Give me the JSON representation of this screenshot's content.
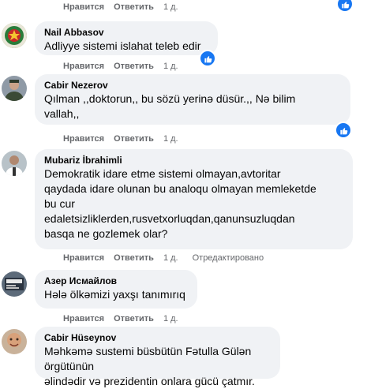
{
  "labels": {
    "like": "Нравится",
    "reply": "Ответить",
    "edited": "Отредактировано"
  },
  "comments": [
    {
      "author": "Nail Abbasov",
      "text": "Adliyye sistemi islahat teleb edir",
      "time": "1 д.",
      "reaction": "like-icon"
    },
    {
      "author": "Cabir Nezerov",
      "text": "Qılman ,,doktorun,, bu sözü yerinə düsür.,, Nə bilim\nvallah,,",
      "time": "1 д.",
      "reaction": "like-icon"
    },
    {
      "author": "Mubariz İbrahimli",
      "text": "Demokratik idare etme sistemi olmayan,avtoritar\nqaydada idare olunan bu analoqu olmayan memleketde\nbu cur\nedaletsizliklerden,rusvetxorluqdan,qanunsuzluqdan\nbasqa ne gozlemek olar?",
      "time": "1 д."
    },
    {
      "author": "Азер Исмайлов",
      "text": "Hələ ölkəmizi yaxşı tanımırıq",
      "time": "1 д."
    },
    {
      "author": "Cabir Hüseynov",
      "text": "Məhkəmə sustemi büsbütün Fətulla Gülən örgütünün\nəlindədir və prezidentin onlara gücü çatmır."
    }
  ],
  "top_actions": {
    "time": "1 д."
  },
  "colors": {
    "like_blue": "#1877f2",
    "bubble": "#f0f2f5",
    "meta": "#65676b"
  }
}
